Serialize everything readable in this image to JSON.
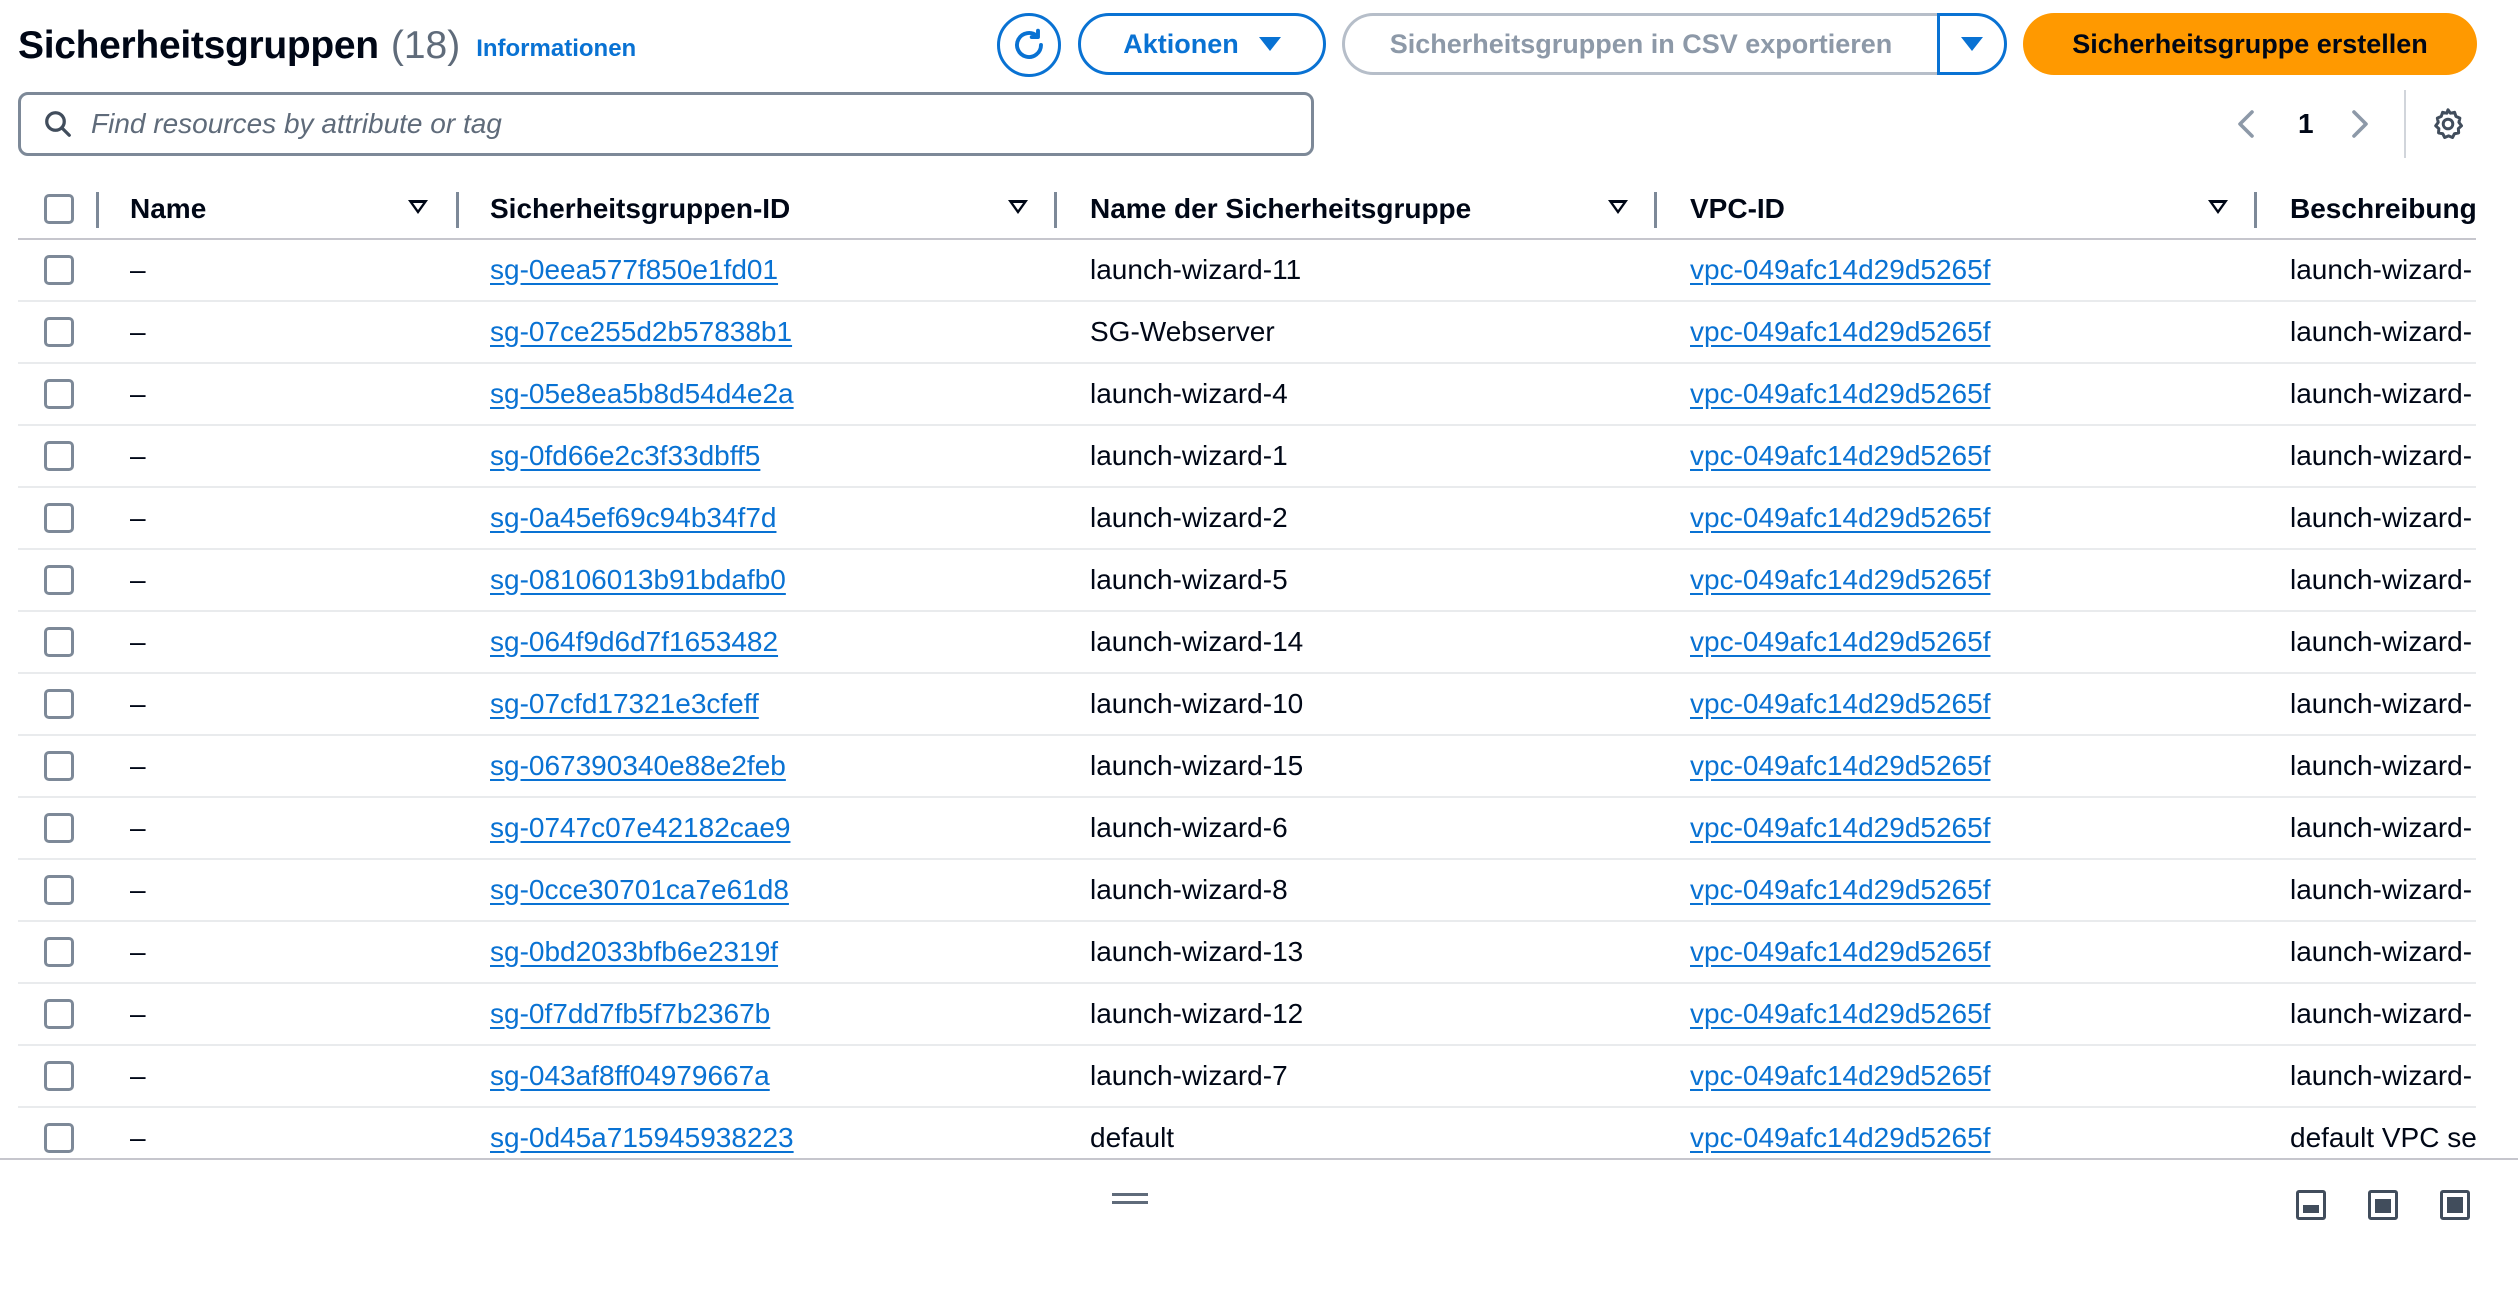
{
  "header": {
    "title": "Sicherheitsgruppen",
    "count": "(18)",
    "info_link": "Informationen",
    "actions_label": "Aktionen",
    "export_label": "Sicherheitsgruppen in CSV exportieren",
    "create_label": "Sicherheitsgruppe erstellen",
    "accent_color": "#0972d3",
    "primary_color": "#ff9900"
  },
  "search": {
    "placeholder": "Find resources by attribute or tag",
    "value": ""
  },
  "pagination": {
    "current_page": "1"
  },
  "table": {
    "columns": [
      "Name",
      "Sicherheitsgruppen-ID",
      "Name der Sicherheitsgruppe",
      "VPC-ID",
      "Beschreibung"
    ],
    "rows": [
      {
        "name": "–",
        "id": "sg-0eea577f850e1fd01",
        "group_name": "launch-wizard-11",
        "vpc": "vpc-049afc14d29d5265f",
        "description": "launch-wizard-"
      },
      {
        "name": "–",
        "id": "sg-07ce255d2b57838b1",
        "group_name": "SG-Webserver",
        "vpc": "vpc-049afc14d29d5265f",
        "description": "launch-wizard-"
      },
      {
        "name": "–",
        "id": "sg-05e8ea5b8d54d4e2a",
        "group_name": "launch-wizard-4",
        "vpc": "vpc-049afc14d29d5265f",
        "description": "launch-wizard-"
      },
      {
        "name": "–",
        "id": "sg-0fd66e2c3f33dbff5",
        "group_name": "launch-wizard-1",
        "vpc": "vpc-049afc14d29d5265f",
        "description": "launch-wizard-"
      },
      {
        "name": "–",
        "id": "sg-0a45ef69c94b34f7d",
        "group_name": "launch-wizard-2",
        "vpc": "vpc-049afc14d29d5265f",
        "description": "launch-wizard-"
      },
      {
        "name": "–",
        "id": "sg-08106013b91bdafb0",
        "group_name": "launch-wizard-5",
        "vpc": "vpc-049afc14d29d5265f",
        "description": "launch-wizard-"
      },
      {
        "name": "–",
        "id": "sg-064f9d6d7f1653482",
        "group_name": "launch-wizard-14",
        "vpc": "vpc-049afc14d29d5265f",
        "description": "launch-wizard-"
      },
      {
        "name": "–",
        "id": "sg-07cfd17321e3cfeff",
        "group_name": "launch-wizard-10",
        "vpc": "vpc-049afc14d29d5265f",
        "description": "launch-wizard-"
      },
      {
        "name": "–",
        "id": "sg-067390340e88e2feb",
        "group_name": "launch-wizard-15",
        "vpc": "vpc-049afc14d29d5265f",
        "description": "launch-wizard-"
      },
      {
        "name": "–",
        "id": "sg-0747c07e42182cae9",
        "group_name": "launch-wizard-6",
        "vpc": "vpc-049afc14d29d5265f",
        "description": "launch-wizard-"
      },
      {
        "name": "–",
        "id": "sg-0cce30701ca7e61d8",
        "group_name": "launch-wizard-8",
        "vpc": "vpc-049afc14d29d5265f",
        "description": "launch-wizard-"
      },
      {
        "name": "–",
        "id": "sg-0bd2033bfb6e2319f",
        "group_name": "launch-wizard-13",
        "vpc": "vpc-049afc14d29d5265f",
        "description": "launch-wizard-"
      },
      {
        "name": "–",
        "id": "sg-0f7dd7fb5f7b2367b",
        "group_name": "launch-wizard-12",
        "vpc": "vpc-049afc14d29d5265f",
        "description": "launch-wizard-"
      },
      {
        "name": "–",
        "id": "sg-043af8ff04979667a",
        "group_name": "launch-wizard-7",
        "vpc": "vpc-049afc14d29d5265f",
        "description": "launch-wizard-"
      },
      {
        "name": "–",
        "id": "sg-0d45a715945938223",
        "group_name": "default",
        "vpc": "vpc-049afc14d29d5265f",
        "description": "default VPC se"
      }
    ]
  },
  "icons": {
    "refresh": "refresh-icon",
    "search": "search-icon",
    "settings": "gear-icon",
    "prev": "chevron-left-icon",
    "next": "chevron-right-icon",
    "drag": "drag-handle-icon",
    "panel_bottom": "panel-bottom-icon",
    "panel_side": "panel-side-icon",
    "panel_full": "panel-full-icon"
  }
}
